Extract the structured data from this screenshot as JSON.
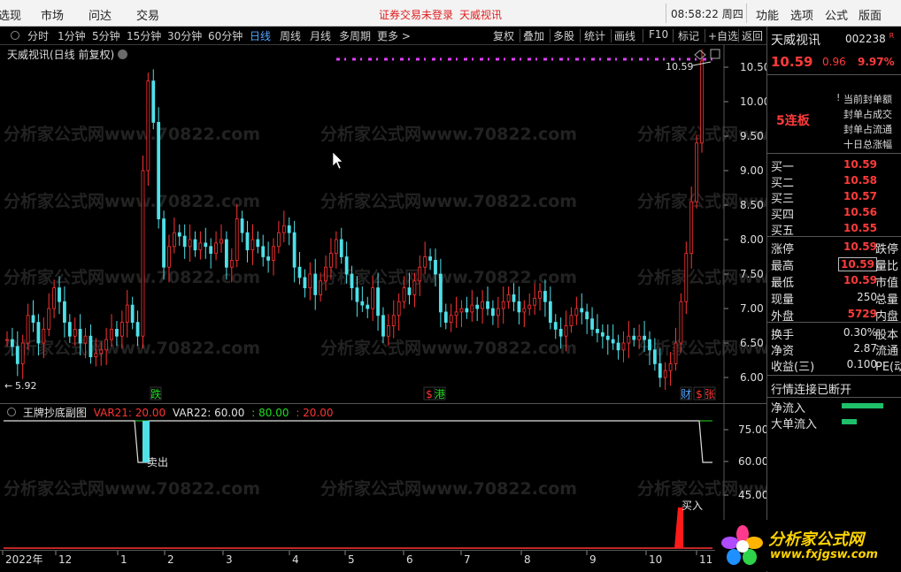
{
  "menu": {
    "items": [
      "选现",
      "市场",
      "问达",
      "交易"
    ],
    "alert": "证券交易未登录",
    "alert_name": "天威视讯",
    "clock": "08:58:22 周四",
    "right_items": [
      "功能",
      "选项",
      "公式",
      "版面"
    ]
  },
  "toolbar": {
    "periods": [
      "分时",
      "1分钟",
      "5分钟",
      "15分钟",
      "30分钟",
      "60分钟",
      "日线",
      "周线",
      "月线",
      "多周期",
      "更多 >"
    ],
    "active_period": "日线",
    "tools": [
      "复权",
      "叠加",
      "多股",
      "统计",
      "画线",
      "F10",
      "标记",
      "+自选",
      "返回"
    ]
  },
  "main_chart": {
    "title": "天威视讯(日线 前复权)",
    "price_axis": [
      "10.50",
      "10.00",
      "9.50",
      "9.00",
      "8.50",
      "8.00",
      "7.50",
      "7.00",
      "6.50",
      "6.00"
    ],
    "last_price_label": "10.59",
    "low_label": "5.92",
    "watermark": "分析家公式网www.70822.com",
    "event_tags": [
      {
        "text": "跌",
        "color": "#22dd22"
      },
      {
        "text": "$",
        "color": "#ff3333"
      },
      {
        "text": "港",
        "color": "#22dd22"
      },
      {
        "text": "财",
        "color": "#52a7ff"
      },
      {
        "text": "$",
        "color": "#ff3333"
      },
      {
        "text": "张",
        "color": "#ff3333"
      }
    ]
  },
  "indicator": {
    "name": "王牌抄底副图",
    "params": [
      {
        "text": "VAR21: 20.00",
        "color": "#ff3333"
      },
      {
        "text": "VAR22: 60.00",
        "color": "#e0e0e0"
      },
      {
        "text": ": 80.00",
        "color": "#22dd22"
      },
      {
        "text": ": 20.00",
        "color": "#ff3333"
      }
    ],
    "axis": [
      "75.00",
      "60.00",
      "45.00"
    ],
    "sell_label": "卖出",
    "buy_label": "买入"
  },
  "date_axis": [
    "2022年",
    "12",
    "1",
    "2",
    "3",
    "4",
    "5",
    "6",
    "7",
    "8",
    "9",
    "10",
    "11"
  ],
  "quote": {
    "name": "天威视讯",
    "code": "002238",
    "code_flag": "R",
    "price": "10.59",
    "change": "0.96",
    "pct": "9.97%",
    "streak": "5连板",
    "notes": [
      "当前封单额",
      "封单占成交",
      "封单占流通",
      "十日总涨幅"
    ],
    "bids": [
      {
        "label": "买一",
        "value": "10.59"
      },
      {
        "label": "买二",
        "value": "10.58"
      },
      {
        "label": "买三",
        "value": "10.57"
      },
      {
        "label": "买四",
        "value": "10.56"
      },
      {
        "label": "买五",
        "value": "10.55"
      }
    ],
    "stats": [
      {
        "label": "涨停",
        "value": "10.59",
        "label2": "跌停",
        "red": true
      },
      {
        "label": "最高",
        "value": "10.59",
        "label2": "量比",
        "red": true,
        "boxed": true
      },
      {
        "label": "最低",
        "value": "10.59",
        "label2": "市值",
        "red": true
      },
      {
        "label": "现量",
        "value": "250",
        "label2": "总量",
        "red": false
      },
      {
        "label": "外盘",
        "value": "5729",
        "label2": "内盘",
        "red": true
      }
    ],
    "stats2": [
      {
        "label": "换手",
        "value": "0.30%",
        "label2": "股本"
      },
      {
        "label": "净资",
        "value": "2.87",
        "label2": "流通"
      },
      {
        "label": "收益(三)",
        "value": "0.100",
        "label2": "PE(动)"
      }
    ],
    "status": "行情连接已断开",
    "fund_flow": [
      {
        "label": "净流入",
        "level": 0.85
      },
      {
        "label": "大单流入",
        "level": 0.3
      }
    ]
  },
  "logo": {
    "brand": "分析家公式网",
    "url": "www.fxjgsw.com"
  },
  "colors": {
    "up": "#ff3333",
    "down": "#4fe0e8",
    "accent": "#52a7ff",
    "dots": "#e040fb"
  }
}
